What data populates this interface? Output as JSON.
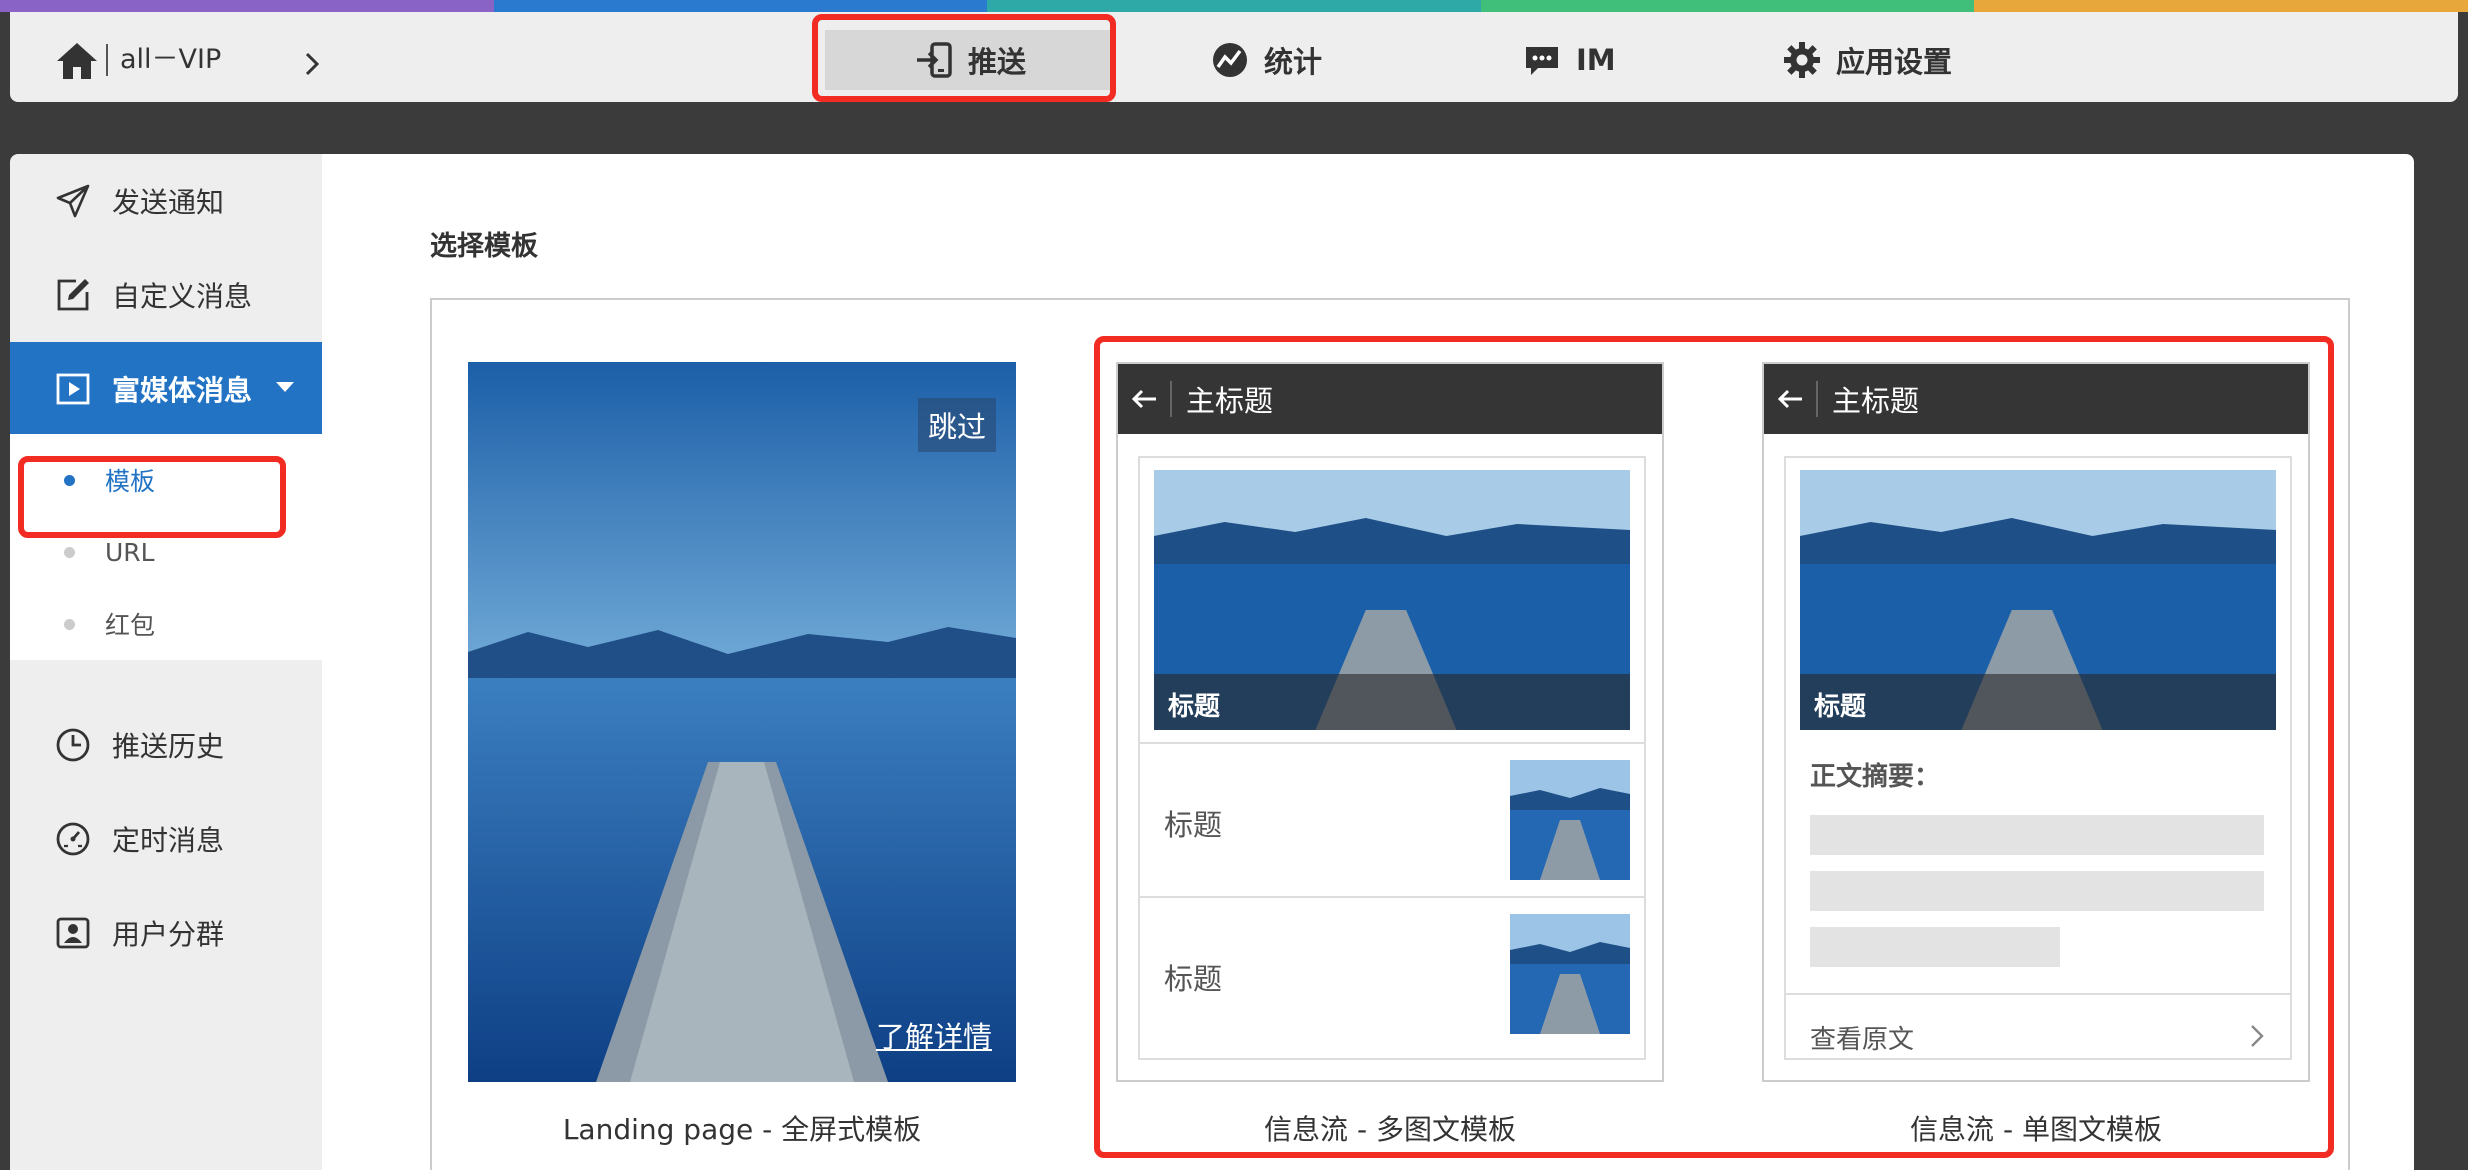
{
  "colors": {
    "stripe": [
      "#8a63c7",
      "#2a7bd0",
      "#2fa9a7",
      "#3fbf7a",
      "#e8a73b"
    ],
    "accent": "#2273c4",
    "highlight": "#f22c22",
    "topbar": "#eeeeee",
    "phone_header": "#353535"
  },
  "topbar": {
    "home_icon": "home-icon",
    "app_name": "all－VIP",
    "chevron_icon": "chevron-right-icon",
    "nav": [
      {
        "label": "推送",
        "icon": "push-icon",
        "active": true
      },
      {
        "label": "统计",
        "icon": "stats-icon"
      },
      {
        "label": "IM",
        "icon": "chat-icon"
      },
      {
        "label": "应用设置",
        "icon": "gear-icon"
      }
    ]
  },
  "sidebar": {
    "items": [
      {
        "label": "发送通知",
        "icon": "send-icon"
      },
      {
        "label": "自定义消息",
        "icon": "edit-icon"
      },
      {
        "label": "富媒体消息",
        "icon": "play-icon",
        "active": true,
        "expanded": true
      },
      {
        "label": "推送历史",
        "icon": "clock-icon"
      },
      {
        "label": "定时消息",
        "icon": "timer-icon"
      },
      {
        "label": "用户分群",
        "icon": "user-group-icon"
      }
    ],
    "sub_items": [
      {
        "label": "模板",
        "active": true
      },
      {
        "label": "URL"
      },
      {
        "label": "红包"
      }
    ]
  },
  "main": {
    "section_title": "选择模板",
    "templates": [
      {
        "name": "Landing page - 全屏式模板",
        "skip": "跳过",
        "detail_link": "了解详情"
      },
      {
        "name": "信息流 - 多图文模板",
        "header_title": "主标题",
        "hero_caption": "标题",
        "rows": [
          "标题",
          "标题"
        ]
      },
      {
        "name": "信息流 - 单图文模板",
        "header_title": "主标题",
        "hero_caption": "标题",
        "summary_label": "正文摘要：",
        "read_more": "查看原文"
      }
    ]
  }
}
